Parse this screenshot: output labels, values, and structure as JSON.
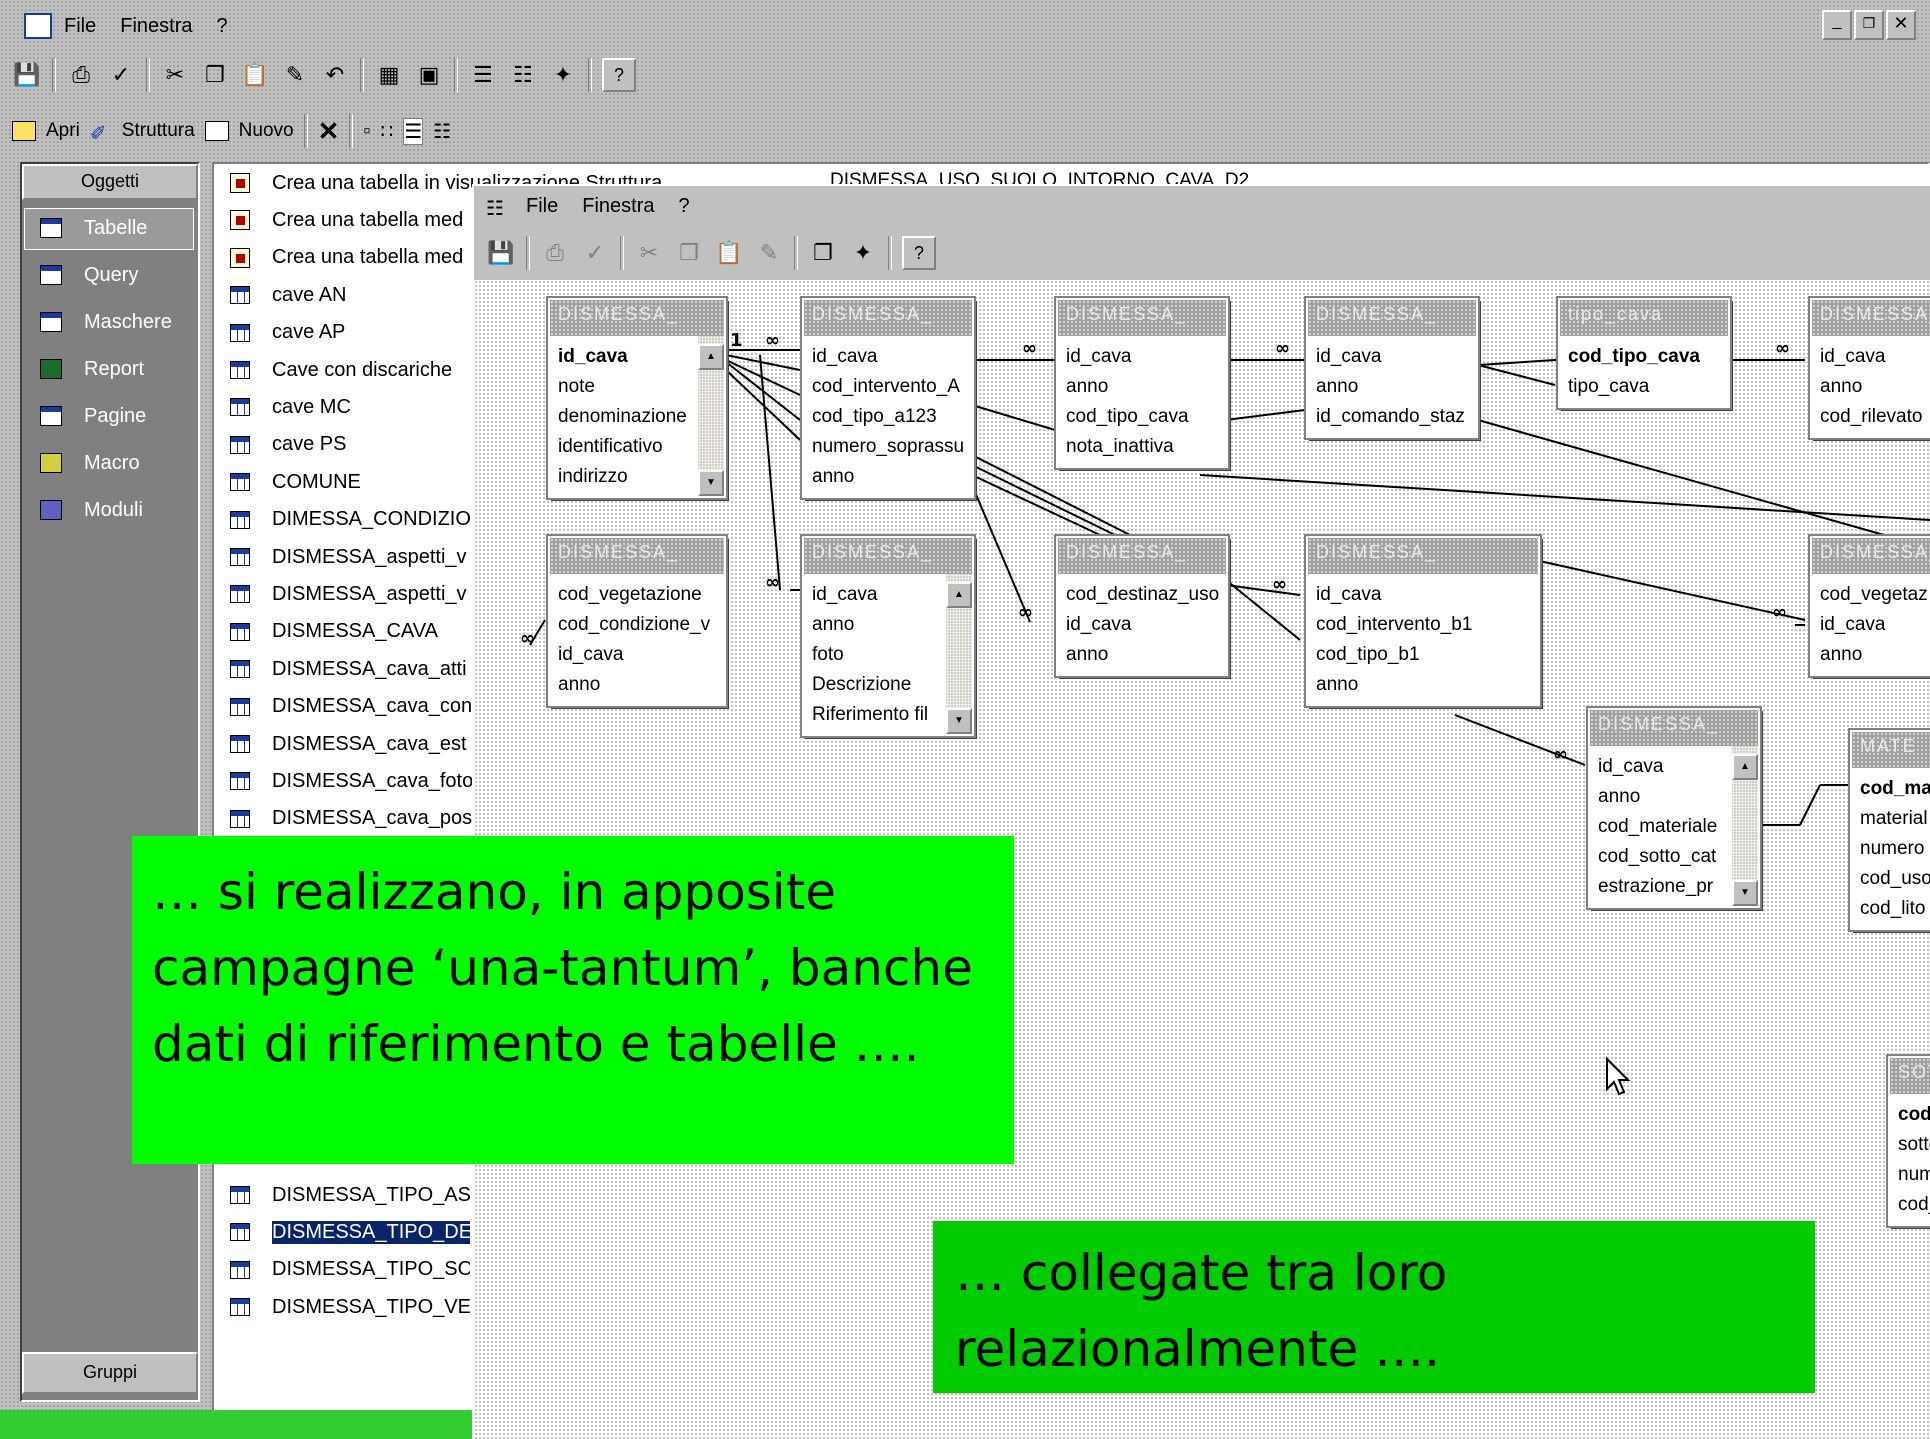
{
  "main_window": {
    "menu": {
      "file": "File",
      "window": "Finestra",
      "help": "?"
    },
    "controls": [
      "_",
      "×"
    ]
  },
  "db_toolbar": {
    "open": "Apri",
    "design": "Struttura",
    "new": "Nuovo",
    "delete": "✕"
  },
  "objects_bar": {
    "header": "Oggetti",
    "items": [
      "Tabelle",
      "Query",
      "Maschere",
      "Report",
      "Pagine",
      "Macro",
      "Moduli"
    ],
    "footer": "Gruppi"
  },
  "object_list": [
    {
      "label": "Crea una tabella in visualizzazione Struttura",
      "icon": "wizard"
    },
    {
      "label": "Crea una tabella med",
      "icon": "wizard"
    },
    {
      "label": "Crea una tabella med",
      "icon": "wizard"
    },
    {
      "label": "cave AN",
      "icon": "table"
    },
    {
      "label": "cave AP",
      "icon": "table"
    },
    {
      "label": "Cave con discariche",
      "icon": "table"
    },
    {
      "label": "cave MC",
      "icon": "table"
    },
    {
      "label": "cave PS",
      "icon": "table"
    },
    {
      "label": "COMUNE",
      "icon": "table"
    },
    {
      "label": "DIMESSA_CONDIZIO",
      "icon": "table"
    },
    {
      "label": "DISMESSA_aspetti_v",
      "icon": "table"
    },
    {
      "label": "DISMESSA_aspetti_v",
      "icon": "table"
    },
    {
      "label": "DISMESSA_CAVA",
      "icon": "table"
    },
    {
      "label": "DISMESSA_cava_atti",
      "icon": "table"
    },
    {
      "label": "DISMESSA_cava_con",
      "icon": "table"
    },
    {
      "label": "DISMESSA_cava_est",
      "icon": "table"
    },
    {
      "label": "DISMESSA_cava_foto",
      "icon": "table"
    },
    {
      "label": "DISMESSA_cava_pos",
      "icon": "table"
    }
  ],
  "object_list_bottom": [
    {
      "label": "DISMESSA_TIPO_ASI",
      "icon": "table",
      "selected": false
    },
    {
      "label": "DISMESSA_TIPO_DES",
      "icon": "table",
      "selected": true
    },
    {
      "label": "DISMESSA_TIPO_SO",
      "icon": "table",
      "selected": false
    },
    {
      "label": "DISMESSA_TIPO_VEG",
      "icon": "table",
      "selected": false
    }
  ],
  "background_list_item": "DISMESSA_USO_SUOLO_INTORNO_CAVA_D2",
  "relationships_window": {
    "menu": {
      "file": "File",
      "window": "Finestra",
      "help": "?"
    }
  },
  "tables": [
    {
      "title": "DISMESSA_",
      "fields": [
        "id_cava",
        "note",
        "denominazione",
        "identificativo",
        "indirizzo"
      ],
      "pk": [
        0
      ],
      "scroll": true
    },
    {
      "title": "DISMESSA_",
      "fields": [
        "id_cava",
        "cod_intervento_A",
        "cod_tipo_a123",
        "numero_soprassu",
        "anno"
      ],
      "pk": [],
      "scroll": false
    },
    {
      "title": "DISMESSA_",
      "fields": [
        "id_cava",
        "anno",
        "cod_tipo_cava",
        "nota_inattiva"
      ],
      "pk": [],
      "scroll": false
    },
    {
      "title": "DISMESSA_",
      "fields": [
        "id_cava",
        "anno",
        "id_comando_staz"
      ],
      "pk": [],
      "scroll": false
    },
    {
      "title": "tipo_cava",
      "fields": [
        "cod_tipo_cava",
        "tipo_cava"
      ],
      "pk": [
        0
      ],
      "scroll": false
    },
    {
      "title": "DISMESSA_",
      "fields": [
        "id_cava",
        "anno",
        "cod_rilevato"
      ],
      "pk": [],
      "scroll": false
    },
    {
      "title": "DISMESSA_",
      "fields": [
        "cod_vegetazione",
        "cod_condizione_v",
        "id_cava",
        "anno"
      ],
      "pk": [],
      "scroll": false
    },
    {
      "title": "DISMESSA_",
      "fields": [
        "id_cava",
        "anno",
        "foto",
        "Descrizione",
        "Riferimento fil"
      ],
      "pk": [],
      "scroll": true
    },
    {
      "title": "DISMESSA_",
      "fields": [
        "cod_destinaz_uso",
        "id_cava",
        "anno"
      ],
      "pk": [],
      "scroll": false
    },
    {
      "title": "DISMESSA_",
      "fields": [
        "id_cava",
        "cod_intervento_b1",
        "cod_tipo_b1",
        "anno"
      ],
      "pk": [],
      "scroll": false
    },
    {
      "title": "DISMESSA_",
      "fields": [
        "cod_vegetaz",
        "id_cava",
        "anno"
      ],
      "pk": [],
      "scroll": false
    },
    {
      "title": "DISMESSA_",
      "fields": [
        "id_cava",
        "anno",
        "cod_materiale",
        "cod_sotto_cat",
        "estrazione_pr"
      ],
      "pk": [],
      "scroll": true
    },
    {
      "title": "MATE",
      "fields": [
        "cod_ma",
        "material",
        "numero",
        "cod_uso",
        "cod_lito"
      ],
      "pk": [
        0
      ],
      "scroll": false
    },
    {
      "title": "SOT",
      "fields": [
        "cod",
        "sotto",
        "num",
        "cod_"
      ],
      "pk": [
        0
      ],
      "scroll": false
    }
  ],
  "captions": {
    "first": "… si realizzano, in apposite campagne ‘una-tantum’, banche dati di riferimento e tabelle ….",
    "second": "… collegate tra loro relazionalmente …."
  },
  "colors": {
    "caption_bright": "#00ff00",
    "caption_dark": "#00cc00",
    "nav_bg": "#808080",
    "selection": "#0a246a"
  }
}
